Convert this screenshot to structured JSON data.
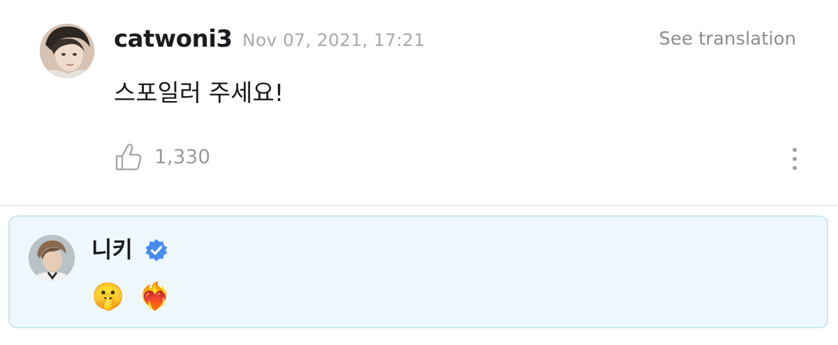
{
  "comment": {
    "author": "catwoni3",
    "timestamp": "Nov 07, 2021, 17:21",
    "translate_label": "See translation",
    "text": "스포일러 주세요!",
    "like_count": "1,330"
  },
  "reply": {
    "author": "니키",
    "verified": true,
    "emojis": [
      "🤫",
      "❤️‍🔥"
    ]
  },
  "colors": {
    "reply_background": "#eef8fc",
    "reply_border": "#c9e7f0",
    "verified_badge": "#4a8bf0"
  },
  "icons": {
    "like": "thumbs-up-icon",
    "more": "more-vertical-icon",
    "verified": "verified-badge-icon"
  }
}
